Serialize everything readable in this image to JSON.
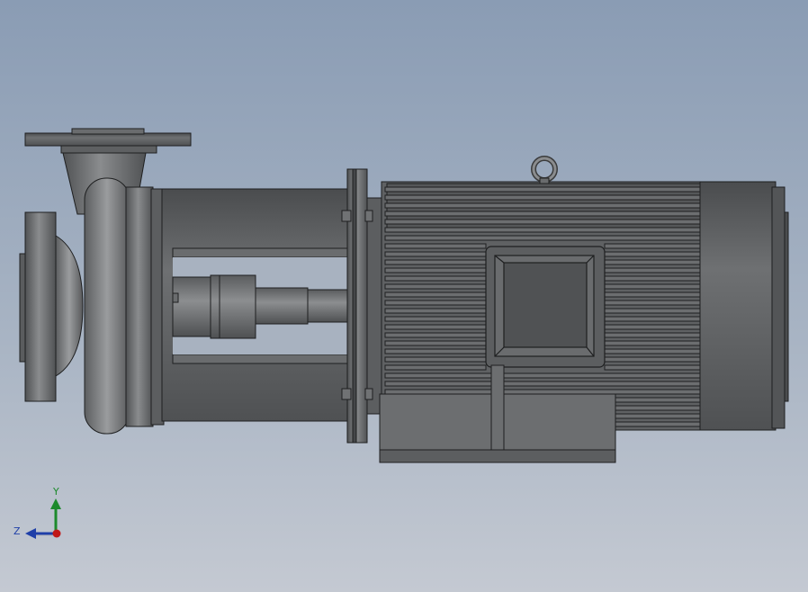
{
  "viewport": {
    "background_top": "#8a9cb4",
    "background_bottom": "#c4c9d2",
    "model_fill": "#5f6163",
    "model_edge": "#1e1f20"
  },
  "triad": {
    "y_label": "Y",
    "z_label": "Z",
    "y_color": "#1c8a2c",
    "z_color": "#1f3fa8",
    "x_color": "#c01818"
  }
}
